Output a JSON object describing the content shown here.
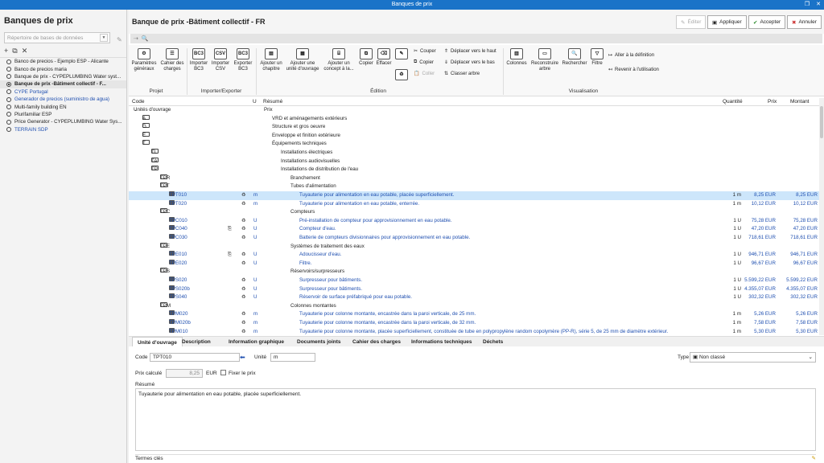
{
  "window": {
    "title": "Banques de prix"
  },
  "left": {
    "title": "Banques de prix",
    "repo_placeholder": "Répertoire de bases de données",
    "items": [
      {
        "label": "Banco de precios - Ejemplo ESP - Alicante",
        "blue": false,
        "selected": false
      },
      {
        "label": "Banco de precios maria",
        "blue": false,
        "selected": false
      },
      {
        "label": "Banque de prix - CYPEPLUMBING Water syst...",
        "blue": false,
        "selected": false
      },
      {
        "label": "Banque de prix -Bâtiment collectif - F...",
        "blue": false,
        "selected": true
      },
      {
        "label": "CYPE Portugal",
        "blue": true,
        "selected": false
      },
      {
        "label": "Generador de precios (suministro de agua)",
        "blue": true,
        "selected": false
      },
      {
        "label": "Multi-family building EN",
        "blue": false,
        "selected": false
      },
      {
        "label": "Plurifamiliar ESP",
        "blue": false,
        "selected": false
      },
      {
        "label": "Price Generator - CYPEPLUMBING Water Sys...",
        "blue": false,
        "selected": false
      },
      {
        "label": "TERRAIN SDP",
        "blue": true,
        "selected": false
      }
    ]
  },
  "main": {
    "title": "Banque de prix -Bâtiment collectif - FR",
    "buttons": {
      "edit": "Éditer",
      "apply": "Appliquer",
      "accept": "Accepter",
      "cancel": "Annuler"
    }
  },
  "ribbon": {
    "params": "Paramètres généraux",
    "cahier": "Cahier des charges",
    "imp_bc3": "Importer BC3",
    "imp_csv": "Importer CSV",
    "exp_bc3": "Exporter BC3",
    "add_chap": "Ajouter un chapitre",
    "add_unit": "Ajouter une unité d'ouvrage",
    "add_concept": "Ajouter un concept à la...",
    "copy": "Copier",
    "erase": "Effacer",
    "cut": "Couper",
    "copy2": "Copier",
    "paste": "Coller",
    "up": "Déplacer vers le haut",
    "down": "Déplacer vers le bas",
    "classify": "Classer arbre",
    "columns": "Colonnes",
    "rebuild": "Reconstruire arbre",
    "search": "Rechercher",
    "filter": "Filtre",
    "goto_def": "Aller à la définition",
    "back": "Revenir à l'utilisation",
    "groups": {
      "projet": "Projet",
      "import": "Importer/Exporter",
      "edition": "Édition",
      "visu": "Visualisation"
    }
  },
  "table": {
    "headers": {
      "code": "Code",
      "u": "U",
      "summary": "Résumé",
      "qty": "Quantité",
      "price": "Prix",
      "amount": "Montant"
    },
    "rows": [
      {
        "level": 0,
        "type": "root",
        "code": "Unités d'ouvrage",
        "summary": "Prix",
        "u": "",
        "qty": "",
        "price": "",
        "amount": ""
      },
      {
        "level": 1,
        "type": "chap",
        "code": "A",
        "summary": "VRD et aménagements extérieurs"
      },
      {
        "level": 1,
        "type": "chap",
        "code": "G",
        "summary": "Structure et gros oeuvre"
      },
      {
        "level": 1,
        "type": "chap",
        "code": "E",
        "summary": "Enveloppe et finition extérieure"
      },
      {
        "level": 1,
        "type": "chapopen",
        "code": "T",
        "summary": "Équipements techniques"
      },
      {
        "level": 2,
        "type": "chap",
        "code": "TL",
        "summary": "Installations électriques"
      },
      {
        "level": 2,
        "type": "chap",
        "code": "TA",
        "summary": "Installations audiovisuelles"
      },
      {
        "level": 2,
        "type": "chapopen",
        "code": "TP",
        "summary": "Installations de distribution de l'eau"
      },
      {
        "level": 3,
        "type": "chap",
        "code": "TPR",
        "summary": "Branchement"
      },
      {
        "level": 3,
        "type": "chapopen",
        "code": "TPT",
        "summary": "Tubes d'alimentation"
      },
      {
        "level": 4,
        "type": "item",
        "code": "TPT010",
        "summary": "Tuyauterie pour alimentation en eau potable, placée superficiellement.",
        "u": "m",
        "qty": "1 m",
        "price": "8,25 EUR",
        "amount": "8,25 EUR",
        "sel": true
      },
      {
        "level": 4,
        "type": "item",
        "code": "TPT020",
        "summary": "Tuyauterie pour alimentation en eau potable, enterrée.",
        "u": "m",
        "qty": "1 m",
        "price": "10,12 EUR",
        "amount": "10,12 EUR"
      },
      {
        "level": 3,
        "type": "chapopen",
        "code": "TPC",
        "summary": "Compteurs"
      },
      {
        "level": 4,
        "type": "item",
        "code": "TPC010",
        "summary": "Pré-installation de compteur pour approvisionnement en eau potable.",
        "u": "U",
        "qty": "1 U",
        "price": "75,28 EUR",
        "amount": "75,28 EUR"
      },
      {
        "level": 4,
        "type": "item",
        "code": "TPC040",
        "summary": "Compteur d'eau.",
        "u": "U",
        "qty": "1 U",
        "price": "47,20 EUR",
        "amount": "47,20 EUR",
        "extra": true
      },
      {
        "level": 4,
        "type": "item",
        "code": "TPC030",
        "summary": "Batterie de compteurs divisionnaires pour approvisionnement en eau potable.",
        "u": "U",
        "qty": "1 U",
        "price": "718,61 EUR",
        "amount": "718,61 EUR"
      },
      {
        "level": 3,
        "type": "chapopen",
        "code": "TPE",
        "summary": "Systèmes de traitement des eaux"
      },
      {
        "level": 4,
        "type": "item",
        "code": "TPE010",
        "summary": "Adoucisseur d'eau.",
        "u": "U",
        "qty": "1 U",
        "price": "946,71 EUR",
        "amount": "946,71 EUR",
        "extra": true
      },
      {
        "level": 4,
        "type": "item",
        "code": "TPE020",
        "summary": "Filtre.",
        "u": "U",
        "qty": "1 U",
        "price": "96,67 EUR",
        "amount": "96,67 EUR"
      },
      {
        "level": 3,
        "type": "chapopen",
        "code": "TPS",
        "summary": "Réservoirs/surpresseurs"
      },
      {
        "level": 4,
        "type": "item",
        "code": "TPS020",
        "summary": "Surpresseur pour bâtiments.",
        "u": "U",
        "qty": "1 U",
        "price": "5.599,22 EUR",
        "amount": "5.599,22 EUR"
      },
      {
        "level": 4,
        "type": "item",
        "code": "TPS020b",
        "summary": "Surpresseur pour bâtiments.",
        "u": "U",
        "qty": "1 U",
        "price": "4.355,07 EUR",
        "amount": "4.355,07 EUR"
      },
      {
        "level": 4,
        "type": "item",
        "code": "TPS040",
        "summary": "Réservoir de surface préfabriqué pour eau potable.",
        "u": "U",
        "qty": "1 U",
        "price": "302,32 EUR",
        "amount": "302,32 EUR"
      },
      {
        "level": 3,
        "type": "chapopen",
        "code": "TPM",
        "summary": "Colonnes montantes"
      },
      {
        "level": 4,
        "type": "item",
        "code": "TPM020",
        "summary": "Tuyauterie pour colonne montante, encastrée dans la paroi verticale, de 25 mm.",
        "u": "m",
        "qty": "1 m",
        "price": "5,26 EUR",
        "amount": "5,26 EUR"
      },
      {
        "level": 4,
        "type": "item",
        "code": "TPM020b",
        "summary": "Tuyauterie pour colonne montante, encastrée dans la paroi verticale, de 32 mm.",
        "u": "m",
        "qty": "1 m",
        "price": "7,58 EUR",
        "amount": "7,58 EUR"
      },
      {
        "level": 4,
        "type": "item",
        "code": "TPM010",
        "summary": "Tuyauterie pour colonne montante, placée superficiellement, constituée de tube en polypropylène random copolymère (PP-R), série 5, de 25 mm de diamètre extérieur.",
        "u": "m",
        "qty": "1 m",
        "price": "5,30 EUR",
        "amount": "5,30 EUR"
      }
    ]
  },
  "tabs": [
    "Unité d'ouvrage",
    "Description",
    "Information graphique",
    "Documents joints",
    "Cahier des charges",
    "Informations techniques",
    "Déchets"
  ],
  "detail": {
    "code_label": "Code",
    "code_value": "TPT010",
    "unit_label": "Unité",
    "unit_value": "m",
    "type_label": "Type",
    "type_value": "Non classé",
    "price_label": "Prix calculé",
    "price_value": "8,25",
    "price_unit": "EUR",
    "fix_label": "Fixer le prix",
    "summary_label": "Résumé",
    "summary_value": "Tuyauterie pour alimentation en eau potable, placée superficiellement.",
    "keywords_label": "Termes clés"
  }
}
